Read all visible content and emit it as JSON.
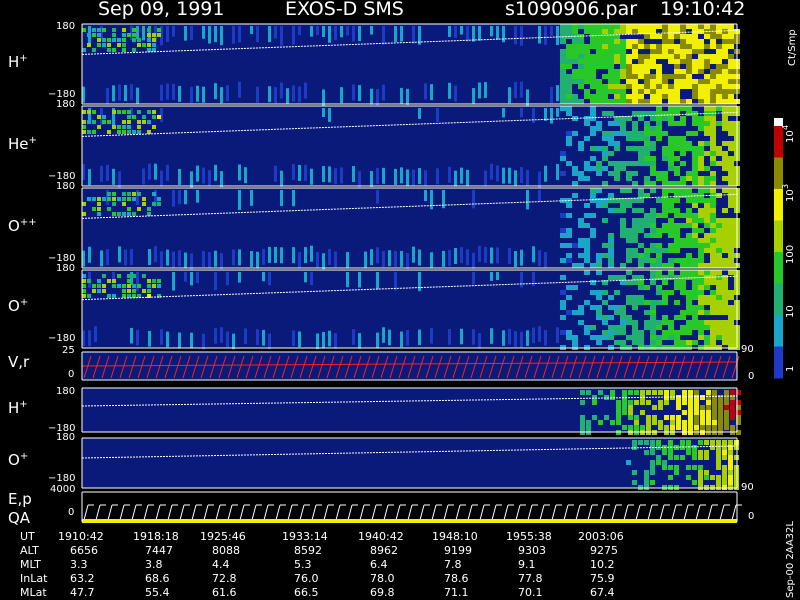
{
  "header": {
    "date": "Sep 09, 1991",
    "instrument": "EXOS-D SMS",
    "file": "s1090906.par",
    "time": "19:10:42"
  },
  "colorbar": {
    "unit": "Ct/Smp",
    "labels": [
      "10",
      "4",
      "10",
      "3",
      "100",
      "10",
      "1"
    ]
  },
  "side_label": "Sep-00 2AA32L",
  "panels": [
    {
      "ion_base": "H",
      "ion_sup": "+",
      "ytop": "180",
      "ybot": "−180"
    },
    {
      "ion_base": "He",
      "ion_sup": "+",
      "ytop": "180",
      "ybot": "−180"
    },
    {
      "ion_base": "O",
      "ion_sup": "++",
      "ytop": "180",
      "ybot": "−180"
    },
    {
      "ion_base": "O",
      "ion_sup": "+",
      "ytop": "180",
      "ybot": "−180"
    },
    {
      "ion_base": "V,r",
      "ion_sup": "",
      "ytop": "25",
      "ybot": "0",
      "right_top": "90",
      "right_bot": "0"
    },
    {
      "ion_base": "H",
      "ion_sup": "+",
      "ytop": "180",
      "ybot": "−180"
    },
    {
      "ion_base": "O",
      "ion_sup": "+",
      "ytop": "180",
      "ybot": "−180",
      "right_bot": "90"
    },
    {
      "ion_base": "E,p",
      "ion_sup": "",
      "ion2": "QA",
      "ytop": "4000",
      "ybot": "0",
      "right_bot": "0"
    }
  ],
  "ephemeris": {
    "rows": [
      {
        "label": "UT",
        "values": [
          "1910:42",
          "1918:18",
          "1925:46",
          "1933:14",
          "1940:42",
          "1948:10",
          "1955:38",
          "2003:06"
        ]
      },
      {
        "label": "ALT",
        "values": [
          "6656",
          "7447",
          "8088",
          "8592",
          "8962",
          "9199",
          "9303",
          "9275"
        ]
      },
      {
        "label": "MLT",
        "values": [
          "3.3",
          "3.8",
          "4.4",
          "5.3",
          "6.4",
          "7.8",
          "9.1",
          "10.2"
        ]
      },
      {
        "label": "InLat",
        "values": [
          "63.2",
          "68.6",
          "72.8",
          "76.0",
          "78.0",
          "78.6",
          "77.8",
          "75.9"
        ]
      },
      {
        "label": "MLat",
        "values": [
          "47.7",
          "55.4",
          "61.6",
          "66.5",
          "69.8",
          "71.1",
          "70.1",
          "67.4"
        ]
      }
    ]
  },
  "chart_data": {
    "type": "heatmap",
    "title": "Sep 09, 1991   EXOS-D SMS   s1090906.par   19:10:42",
    "x_ticks": [
      "1910:42",
      "1918:18",
      "1925:46",
      "1933:14",
      "1940:42",
      "1948:10",
      "1955:38",
      "2003:06"
    ],
    "colorscale": {
      "unit": "Ct/Smp",
      "min": 1,
      "max": 10000,
      "log": true,
      "colors": [
        "#0a1a7a",
        "#1c3cc8",
        "#1aa6c8",
        "#22b070",
        "#28c828",
        "#a8d000",
        "#f0f000",
        "#8a8a00",
        "#c00000"
      ]
    },
    "panels": [
      {
        "name": "H+",
        "ylim": [
          -180,
          180
        ]
      },
      {
        "name": "He+",
        "ylim": [
          -180,
          180
        ]
      },
      {
        "name": "O++",
        "ylim": [
          -180,
          180
        ]
      },
      {
        "name": "O+",
        "ylim": [
          -180,
          180
        ]
      },
      {
        "name": "V,r",
        "ylim": [
          0,
          25
        ]
      },
      {
        "name": "H+",
        "ylim": [
          -180,
          180
        ]
      },
      {
        "name": "O+",
        "ylim": [
          -180,
          180
        ]
      },
      {
        "name": "E,p",
        "ylim": [
          0,
          4000
        ]
      }
    ]
  }
}
